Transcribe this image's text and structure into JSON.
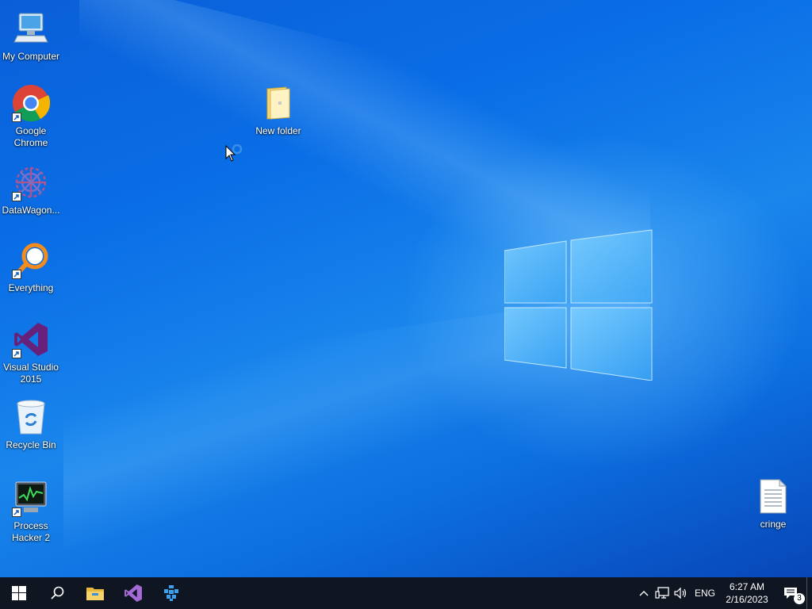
{
  "desktop": {
    "icons": [
      {
        "label": "My Computer",
        "icon": "computer-icon"
      },
      {
        "label": "Google Chrome",
        "icon": "chrome-icon"
      },
      {
        "label": "DataWagon...",
        "icon": "datawagon-icon"
      },
      {
        "label": "Everything",
        "icon": "everything-search-icon"
      },
      {
        "label": "Visual Studio 2015",
        "icon": "visual-studio-icon"
      },
      {
        "label": "Recycle Bin",
        "icon": "recycle-bin-icon"
      },
      {
        "label": "Process Hacker 2",
        "icon": "process-hacker-icon"
      },
      {
        "label": "New folder",
        "icon": "folder-icon"
      },
      {
        "label": "cringe",
        "icon": "text-file-icon"
      }
    ]
  },
  "taskbar": {
    "pinned": [
      "start-icon",
      "search-icon",
      "file-explorer-icon",
      "visual-studio-icon",
      "app-icon"
    ],
    "tray": {
      "language": "ENG",
      "time": "6:27 AM",
      "date": "2/16/2023",
      "notification_count": "3"
    }
  },
  "colors": {
    "desktop_blue": "#0a6ee6",
    "taskbar": "#101621",
    "vs_purple": "#68217a"
  }
}
